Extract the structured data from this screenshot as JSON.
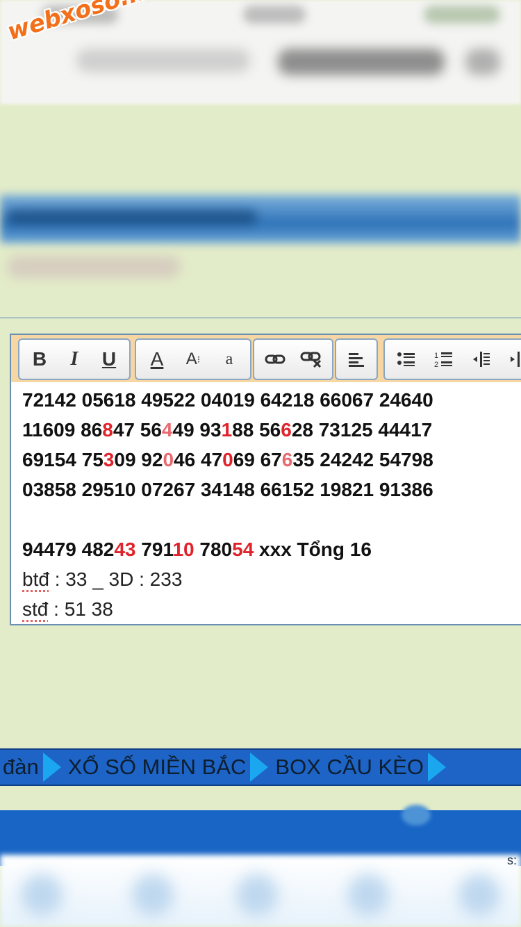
{
  "watermark": "webxoso.net",
  "toolbar": {
    "bold": "B",
    "italic": "I",
    "underline": "U",
    "font_color": "A",
    "font_size": "A",
    "font_face": "a"
  },
  "content": {
    "lines": [
      [
        {
          "t": "72142 05618 49522 04019 64218 66067 24640",
          "c": "num"
        }
      ],
      [
        {
          "t": "11609 ",
          "c": "num"
        },
        {
          "t": "86",
          "c": "num"
        },
        {
          "t": "8",
          "c": "red"
        },
        {
          "t": "47 56",
          "c": "num"
        },
        {
          "t": "4",
          "c": "pink"
        },
        {
          "t": "49 93",
          "c": "num"
        },
        {
          "t": "1",
          "c": "red"
        },
        {
          "t": "88 56",
          "c": "num"
        },
        {
          "t": "6",
          "c": "red"
        },
        {
          "t": "28 73125 44417",
          "c": "num"
        }
      ],
      [
        {
          "t": "69154 75",
          "c": "num"
        },
        {
          "t": "3",
          "c": "red"
        },
        {
          "t": "09 92",
          "c": "num"
        },
        {
          "t": "0",
          "c": "pink"
        },
        {
          "t": "46 47",
          "c": "num"
        },
        {
          "t": "0",
          "c": "red"
        },
        {
          "t": "69 67",
          "c": "num"
        },
        {
          "t": "6",
          "c": "pink"
        },
        {
          "t": "35 24242 54798",
          "c": "num"
        }
      ],
      [
        {
          "t": "03858 29510 07267 34148 66152 19821 91386",
          "c": "num"
        }
      ]
    ],
    "summary": [
      {
        "t": "94479 482",
        "c": "num"
      },
      {
        "t": "43",
        "c": "red"
      },
      {
        "t": " 791",
        "c": "num"
      },
      {
        "t": "10",
        "c": "red"
      },
      {
        "t": " 780",
        "c": "num"
      },
      {
        "t": "54",
        "c": "red"
      },
      {
        "t": " xxx Tổng 16",
        "c": "num"
      }
    ],
    "btd_label": "btđ",
    "btd_value": " : 33 _ 3D : 233",
    "std_label": "stđ",
    "std_value": " : 51 38"
  },
  "nav": {
    "items": [
      "đàn",
      "XỔ SỐ MIỀN BẮC",
      "BOX CẦU KÈO"
    ]
  },
  "footer_letter": "s:"
}
